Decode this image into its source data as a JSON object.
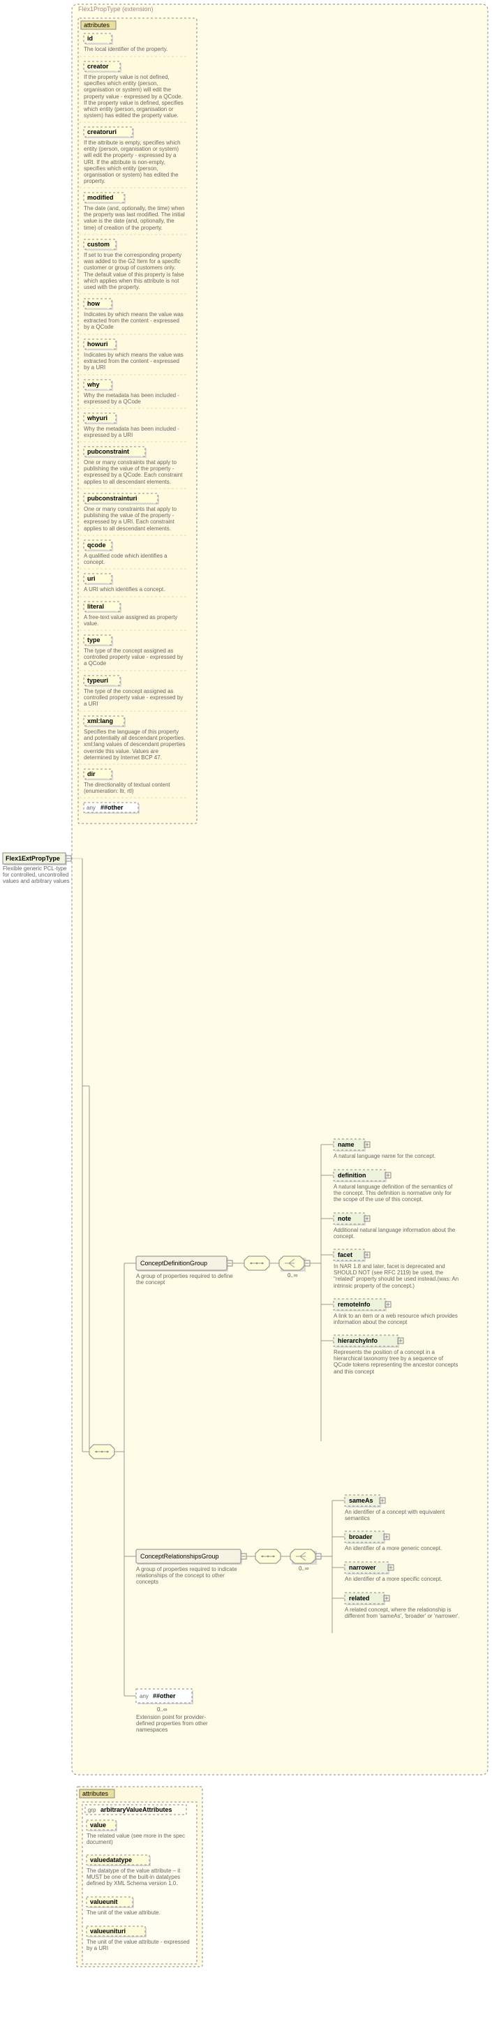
{
  "root": {
    "name": "Flex1ExtPropType",
    "desc": "Flexible generic PCL-type for controlled, uncontrolled values and arbitrary values"
  },
  "ext_title": "Flex1PropType (extension)",
  "attr_header": "attributes",
  "attributes": [
    {
      "name": "id",
      "desc": "The local identifier of the property.",
      "d": true
    },
    {
      "name": "creator",
      "desc": "If the property value is not defined, specifies which entity (person, organisation or system) will edit the property value - expressed by a QCode. If the property value is defined, specifies which entity (person, organisation or system) has edited the property value.",
      "d": true
    },
    {
      "name": "creatoruri",
      "desc": "If the attribute is empty, specifies which entity (person, organisation or system) will edit the property - expressed by a URI. If the attribute is non-empty, specifies which entity (person, organisation or system) has edited the property.",
      "d": true
    },
    {
      "name": "modified",
      "desc": "The date (and, optionally, the time) when the property was last modified. The initial value is the date (and, optionally, the time) of creation of the property.",
      "d": true
    },
    {
      "name": "custom",
      "desc": "If set to true the corresponding property was added to the G2 Item for a specific customer or group of customers only. The default value of this property is false which applies when this attribute is not used with the property.",
      "d": true
    },
    {
      "name": "how",
      "desc": "Indicates by which means the value was extracted from the content - expressed by a QCode",
      "d": true
    },
    {
      "name": "howuri",
      "desc": "Indicates by which means the value was extracted from the content - expressed by a URI",
      "d": true
    },
    {
      "name": "why",
      "desc": "Why the metadata has been included - expressed by a QCode",
      "d": true
    },
    {
      "name": "whyuri",
      "desc": "Why the metadata has been included - expressed by a URI",
      "d": true
    },
    {
      "name": "pubconstraint",
      "desc": "One or many constraints that apply to publishing the value of the property - expressed by a QCode. Each constraint applies to all descendant elements.",
      "d": true
    },
    {
      "name": "pubconstrainturi",
      "desc": "One or many constraints that apply to publishing the value of the property - expressed by a URI. Each constraint applies to all descendant elements.",
      "d": true
    },
    {
      "name": "qcode",
      "desc": "A qualified code which identifies a concept.",
      "d": true
    },
    {
      "name": "uri",
      "desc": "A URI which identifies a concept.",
      "d": true
    },
    {
      "name": "literal",
      "desc": "A free-text value assigned as property value.",
      "d": true
    },
    {
      "name": "type",
      "desc": "The type of the concept assigned as controlled property value - expressed by a QCode",
      "d": true
    },
    {
      "name": "typeuri",
      "desc": "The type of the concept assigned as controlled property value - expressed by a URI",
      "d": true
    },
    {
      "name": "xml:lang",
      "desc": "Specifies the language of this property and potentially all descendant properties. xml:lang values of descendant properties override this value. Values are determined by Internet BCP 47.",
      "d": true
    },
    {
      "name": "dir",
      "desc": "The directionality of textual content (enumeration: ltr, rtl)",
      "d": true
    }
  ],
  "any_other": "##other",
  "any_other_prefix": "any ",
  "cdg": {
    "name": "ConceptDefinitionGroup",
    "desc": "A group of properties required to define the concept",
    "card": "0..∞",
    "children": [
      {
        "name": "name",
        "desc": "A natural language name for the concept."
      },
      {
        "name": "definition",
        "desc": "A natural language definition of the semantics of the concept. This definition is normative only for the scope of the use of this concept."
      },
      {
        "name": "note",
        "desc": "Additional natural language information about the concept."
      },
      {
        "name": "facet",
        "desc": "In NAR 1.8 and later, facet is deprecated and SHOULD NOT (see RFC 2119) be used, the \"related\" property should be used instead.(was: An intrinsic property of the concept.)"
      },
      {
        "name": "remoteInfo",
        "desc": "A link to an item or a web resource which provides information about the concept"
      },
      {
        "name": "hierarchyInfo",
        "desc": "Represents the position of a concept in a hierarchical taxonomy tree by a sequence of QCode tokens representing the ancestor concepts and this concept"
      }
    ]
  },
  "crg": {
    "name": "ConceptRelationshipsGroup",
    "desc": "A group of properties required to indicate relationships of the concept to other concepts",
    "card": "0..∞",
    "children": [
      {
        "name": "sameAs",
        "desc": "An identifier of a concept with equivalent semantics"
      },
      {
        "name": "broader",
        "desc": "An identifier of a more generic concept."
      },
      {
        "name": "narrower",
        "desc": "An identifier of a more specific concept."
      },
      {
        "name": "related",
        "desc": "A related concept, where the relationship is different from 'sameAs', 'broader' or 'narrower'."
      }
    ]
  },
  "bottom_any": {
    "prefix": "any ",
    "name": "##other",
    "card": "0..∞",
    "desc": "Extension point for provider-defined properties from other namespaces"
  },
  "ava": {
    "grp_prefix": "grp ",
    "group_title": "arbitraryValueAttributes",
    "attrs": [
      {
        "name": "value",
        "desc": "The related value (see more in the spec document)"
      },
      {
        "name": "valuedatatype",
        "desc": "The datatype of the value attribute – it MUST be one of the built-in datatypes defined by XML Schema version 1.0."
      },
      {
        "name": "valueunit",
        "desc": "The unit of the value attribute."
      },
      {
        "name": "valueunituri",
        "desc": "The unit of the value attribute - expressed by a URI"
      }
    ]
  }
}
